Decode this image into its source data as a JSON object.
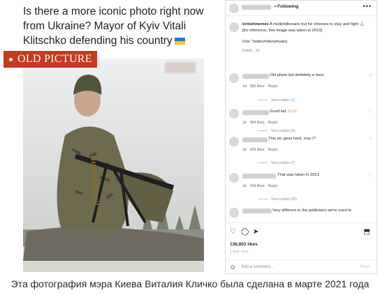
{
  "post": {
    "headline": "Is there a more iconic photo right now from Ukraine? Mayor of Kyiv Vitali Klitschko defending his country",
    "badge": "OLD PICTURE"
  },
  "instagram": {
    "follow_label": "• Following",
    "more_label": "•••",
    "caption_user": "britishmemes",
    "caption_text": "A multimillionaire but he chooses to stay and fight 🙏🏻",
    "caption_note": "[for reference, this image was taken in 2019]",
    "caption_via": "(Via: Twitter/mikewhoatv)",
    "caption_edited": "Edited · 1d",
    "comments": [
      {
        "text": "Old photo but definitely a hero.",
        "age": "1d",
        "likes": "583 likes",
        "reply": "Reply",
        "view_replies": "View replies (2)"
      },
      {
        "text": "Good lad 🙌🏻🙌🏻",
        "age": "1d",
        "likes": "454 likes",
        "reply": "Reply",
        "view_replies": "View replies (4)"
      },
      {
        "text": "This pic goes hard, may I?",
        "age": "1d",
        "likes": "639 likes",
        "reply": "Reply",
        "view_replies": "View replies (7)"
      },
      {
        "text": "That was taken in 2021",
        "age": "1d",
        "likes": "418 likes",
        "reply": "Reply",
        "view_replies": "View replies (30)"
      },
      {
        "text": "Very different to the politicians we're used to",
        "age": "",
        "likes": "",
        "reply": "",
        "view_replies": ""
      }
    ],
    "likes_count": "136,803 likes",
    "time_ago": "1 DAY AGO",
    "add_comment_placeholder": "Add a comment...",
    "post_label": "Post"
  },
  "footer_caption": "Эта фотография мэра Киева Виталия Кличко была сделана в марте 2021 года",
  "colors": {
    "badge": "#c53a21",
    "post_link": "#b2dffc"
  }
}
